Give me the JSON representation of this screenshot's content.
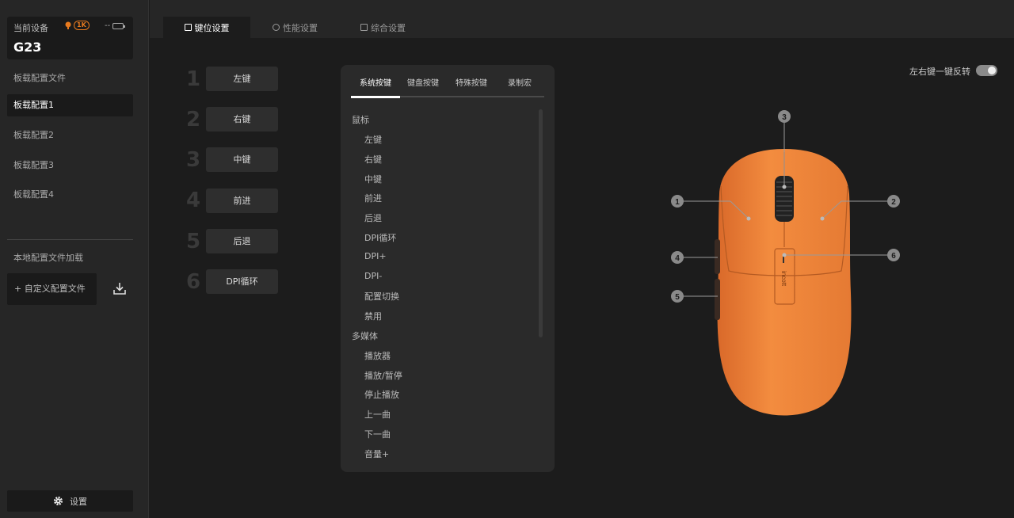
{
  "sidebar": {
    "device_label": "当前设备",
    "device_name": "G23",
    "rate_badge": "1K",
    "battery_text": "--",
    "onboard_title": "板载配置文件",
    "profiles": [
      {
        "label": "板载配置1",
        "active": true
      },
      {
        "label": "板载配置2",
        "active": false
      },
      {
        "label": "板载配置3",
        "active": false
      },
      {
        "label": "板载配置4",
        "active": false
      }
    ],
    "local_title": "本地配置文件加载",
    "custom_button": "+ 自定义配置文件",
    "settings_label": "设置"
  },
  "top_tabs": [
    {
      "label": "键位设置",
      "icon": "keys-icon",
      "active": true
    },
    {
      "label": "性能设置",
      "icon": "gauge-icon",
      "active": false
    },
    {
      "label": "综合设置",
      "icon": "panel-icon",
      "active": false
    }
  ],
  "keys": [
    {
      "num": "1",
      "label": "左键"
    },
    {
      "num": "2",
      "label": "右键"
    },
    {
      "num": "3",
      "label": "中键"
    },
    {
      "num": "4",
      "label": "前进"
    },
    {
      "num": "5",
      "label": "后退"
    },
    {
      "num": "6",
      "label": "DPI循环"
    }
  ],
  "panel": {
    "tabs": [
      "系统按键",
      "键盘按键",
      "特殊按键",
      "录制宏"
    ],
    "categories": [
      {
        "label": "鼠标",
        "items": [
          "左键",
          "右键",
          "中键",
          "前进",
          "后退",
          "DPI循环",
          "DPI+",
          "DPI-",
          "配置切换",
          "禁用"
        ]
      },
      {
        "label": "多媒体",
        "items": [
          "播放器",
          "播放/暂停",
          "停止播放",
          "上一曲",
          "下一曲",
          "音量+"
        ]
      }
    ]
  },
  "swap_toggle": {
    "label": "左右键一键反转",
    "on": true
  },
  "mouse": {
    "brand_text": "incott",
    "callouts": [
      "1",
      "2",
      "3",
      "4",
      "5",
      "6"
    ],
    "color": "#f08a3c"
  }
}
